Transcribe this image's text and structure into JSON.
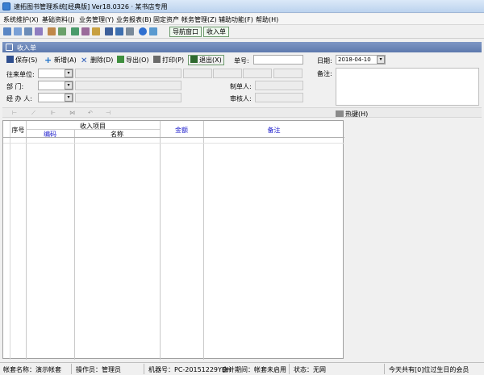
{
  "window": {
    "title": "速拓图书管理系统[经典版] Ver18.0326 · 某书店专用"
  },
  "menu": [
    "系统维护(X)",
    "基础资料(J)",
    "业务管理(Y)",
    "业务报表(B)",
    "固定资产",
    "帐务管理(Z)",
    "辅助功能(F)",
    "帮助(H)"
  ],
  "toolbar": {
    "nav_label": "导航窗口",
    "income_label": "收入单"
  },
  "panel": {
    "title": "收入单"
  },
  "actions": {
    "save": "保存(S)",
    "add": "新增(A)",
    "delete": "删除(D)",
    "export": "导出(O)",
    "print": "打印(P)",
    "exit": "退出(X)"
  },
  "form": {
    "order_no_label": "单号:",
    "date_label": "日期:",
    "date_value": "2018-04-10",
    "remark_label": "备注:",
    "partner_label": "往来单位:",
    "dept_label": "部    门:",
    "handler_label": "经 办 人:",
    "maker_label": "制单人:",
    "auditor_label": "审核人:"
  },
  "hotkey_label": "热键(H)",
  "grid": {
    "seq": "序号",
    "income_item": "收入项目",
    "code": "编码",
    "name": "名称",
    "amount": "金额",
    "remark": "备注"
  },
  "status": {
    "account": "帐套名称：演示帐套",
    "operator": "操作员：管理员",
    "machine": "机器号：PC-20151229YDH",
    "period": "会计期间：帐套未启用",
    "state": "状态：无网",
    "birthday": "今天共有[0]位过生日的会员"
  },
  "colors": {
    "accent_blue": "#5d79ad",
    "header_blue": "#1a1acc",
    "nav_green": "#eef7ee"
  }
}
